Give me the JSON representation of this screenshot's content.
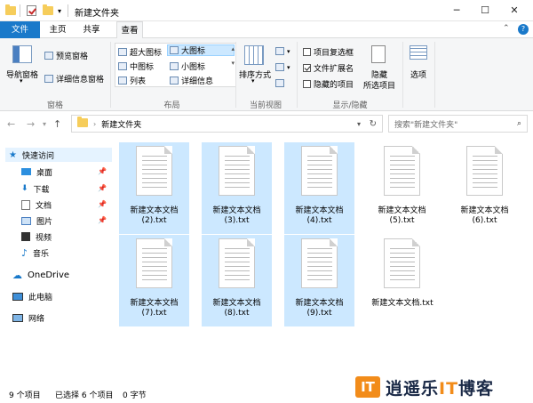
{
  "window": {
    "title": "新建文件夹"
  },
  "tabs": {
    "file": "文件",
    "home": "主页",
    "share": "共享",
    "view": "查看"
  },
  "ribbon": {
    "nav_pane": "导航窗格",
    "preview_pane": "预览窗格",
    "details_pane": "详细信息窗格",
    "panes_group": "窗格",
    "layout": {
      "xlarge": "超大图标",
      "large": "大图标",
      "medium": "中图标",
      "small": "小图标",
      "list": "列表",
      "details": "详细信息"
    },
    "layout_group": "布局",
    "sort": "排序方式",
    "current_view_group": "当前视图",
    "item_checkboxes": "项目复选框",
    "file_extensions": "文件扩展名",
    "hidden_items": "隐藏的项目",
    "hide_selected_1": "隐藏",
    "hide_selected_2": "所选项目",
    "show_hide_group": "显示/隐藏",
    "options": "选项"
  },
  "address": {
    "path": "新建文件夹",
    "search_placeholder": "搜索\"新建文件夹\""
  },
  "sidebar": {
    "quick_access": "快速访问",
    "desktop": "桌面",
    "downloads": "下载",
    "documents": "文档",
    "pictures": "图片",
    "videos": "视频",
    "music": "音乐",
    "onedrive": "OneDrive",
    "this_pc": "此电脑",
    "network": "网络"
  },
  "files": [
    {
      "line1": "新建文本文档",
      "line2": "(2).txt",
      "selected": true
    },
    {
      "line1": "新建文本文档",
      "line2": "(3).txt",
      "selected": true
    },
    {
      "line1": "新建文本文档",
      "line2": "(4).txt",
      "selected": true
    },
    {
      "line1": "新建文本文档",
      "line2": "(5).txt",
      "selected": false
    },
    {
      "line1": "新建文本文档",
      "line2": "(6).txt",
      "selected": false
    },
    {
      "line1": "新建文本文档",
      "line2": "(7).txt",
      "selected": true
    },
    {
      "line1": "新建文本文档",
      "line2": "(8).txt",
      "selected": true
    },
    {
      "line1": "新建文本文档",
      "line2": "(9).txt",
      "selected": true
    },
    {
      "line1": "新建文本文档.txt",
      "line2": "",
      "selected": false
    }
  ],
  "status": {
    "count": "9 个项目",
    "selected": "已选择 6 个项目",
    "size": "0 字节"
  },
  "watermark": {
    "logo": "IT",
    "brand_pre": "逍遥乐",
    "brand_it": "IT",
    "brand_post": "博客"
  },
  "colors": {
    "accent": "#1979ca",
    "selection": "#cce8ff",
    "folder": "#f6cd5b"
  }
}
